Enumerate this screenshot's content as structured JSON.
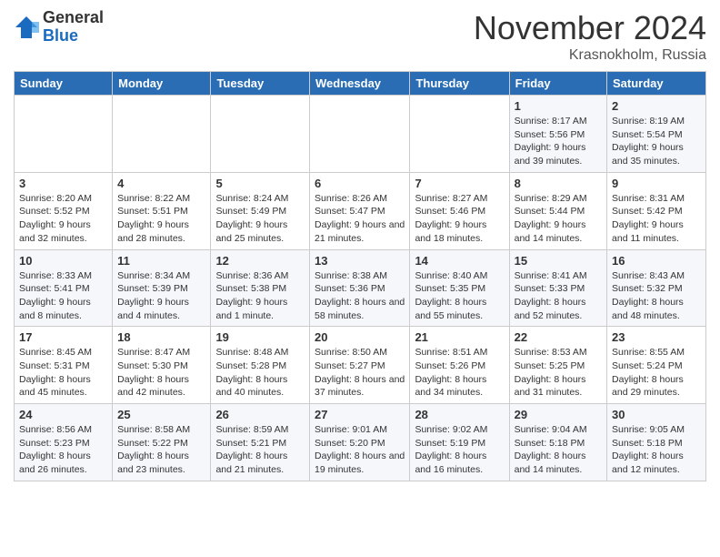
{
  "logo": {
    "general": "General",
    "blue": "Blue"
  },
  "header": {
    "month": "November 2024",
    "location": "Krasnokholm, Russia"
  },
  "weekdays": [
    "Sunday",
    "Monday",
    "Tuesday",
    "Wednesday",
    "Thursday",
    "Friday",
    "Saturday"
  ],
  "weeks": [
    [
      {
        "day": "",
        "info": ""
      },
      {
        "day": "",
        "info": ""
      },
      {
        "day": "",
        "info": ""
      },
      {
        "day": "",
        "info": ""
      },
      {
        "day": "",
        "info": ""
      },
      {
        "day": "1",
        "info": "Sunrise: 8:17 AM\nSunset: 5:56 PM\nDaylight: 9 hours and 39 minutes."
      },
      {
        "day": "2",
        "info": "Sunrise: 8:19 AM\nSunset: 5:54 PM\nDaylight: 9 hours and 35 minutes."
      }
    ],
    [
      {
        "day": "3",
        "info": "Sunrise: 8:20 AM\nSunset: 5:52 PM\nDaylight: 9 hours and 32 minutes."
      },
      {
        "day": "4",
        "info": "Sunrise: 8:22 AM\nSunset: 5:51 PM\nDaylight: 9 hours and 28 minutes."
      },
      {
        "day": "5",
        "info": "Sunrise: 8:24 AM\nSunset: 5:49 PM\nDaylight: 9 hours and 25 minutes."
      },
      {
        "day": "6",
        "info": "Sunrise: 8:26 AM\nSunset: 5:47 PM\nDaylight: 9 hours and 21 minutes."
      },
      {
        "day": "7",
        "info": "Sunrise: 8:27 AM\nSunset: 5:46 PM\nDaylight: 9 hours and 18 minutes."
      },
      {
        "day": "8",
        "info": "Sunrise: 8:29 AM\nSunset: 5:44 PM\nDaylight: 9 hours and 14 minutes."
      },
      {
        "day": "9",
        "info": "Sunrise: 8:31 AM\nSunset: 5:42 PM\nDaylight: 9 hours and 11 minutes."
      }
    ],
    [
      {
        "day": "10",
        "info": "Sunrise: 8:33 AM\nSunset: 5:41 PM\nDaylight: 9 hours and 8 minutes."
      },
      {
        "day": "11",
        "info": "Sunrise: 8:34 AM\nSunset: 5:39 PM\nDaylight: 9 hours and 4 minutes."
      },
      {
        "day": "12",
        "info": "Sunrise: 8:36 AM\nSunset: 5:38 PM\nDaylight: 9 hours and 1 minute."
      },
      {
        "day": "13",
        "info": "Sunrise: 8:38 AM\nSunset: 5:36 PM\nDaylight: 8 hours and 58 minutes."
      },
      {
        "day": "14",
        "info": "Sunrise: 8:40 AM\nSunset: 5:35 PM\nDaylight: 8 hours and 55 minutes."
      },
      {
        "day": "15",
        "info": "Sunrise: 8:41 AM\nSunset: 5:33 PM\nDaylight: 8 hours and 52 minutes."
      },
      {
        "day": "16",
        "info": "Sunrise: 8:43 AM\nSunset: 5:32 PM\nDaylight: 8 hours and 48 minutes."
      }
    ],
    [
      {
        "day": "17",
        "info": "Sunrise: 8:45 AM\nSunset: 5:31 PM\nDaylight: 8 hours and 45 minutes."
      },
      {
        "day": "18",
        "info": "Sunrise: 8:47 AM\nSunset: 5:30 PM\nDaylight: 8 hours and 42 minutes."
      },
      {
        "day": "19",
        "info": "Sunrise: 8:48 AM\nSunset: 5:28 PM\nDaylight: 8 hours and 40 minutes."
      },
      {
        "day": "20",
        "info": "Sunrise: 8:50 AM\nSunset: 5:27 PM\nDaylight: 8 hours and 37 minutes."
      },
      {
        "day": "21",
        "info": "Sunrise: 8:51 AM\nSunset: 5:26 PM\nDaylight: 8 hours and 34 minutes."
      },
      {
        "day": "22",
        "info": "Sunrise: 8:53 AM\nSunset: 5:25 PM\nDaylight: 8 hours and 31 minutes."
      },
      {
        "day": "23",
        "info": "Sunrise: 8:55 AM\nSunset: 5:24 PM\nDaylight: 8 hours and 29 minutes."
      }
    ],
    [
      {
        "day": "24",
        "info": "Sunrise: 8:56 AM\nSunset: 5:23 PM\nDaylight: 8 hours and 26 minutes."
      },
      {
        "day": "25",
        "info": "Sunrise: 8:58 AM\nSunset: 5:22 PM\nDaylight: 8 hours and 23 minutes."
      },
      {
        "day": "26",
        "info": "Sunrise: 8:59 AM\nSunset: 5:21 PM\nDaylight: 8 hours and 21 minutes."
      },
      {
        "day": "27",
        "info": "Sunrise: 9:01 AM\nSunset: 5:20 PM\nDaylight: 8 hours and 19 minutes."
      },
      {
        "day": "28",
        "info": "Sunrise: 9:02 AM\nSunset: 5:19 PM\nDaylight: 8 hours and 16 minutes."
      },
      {
        "day": "29",
        "info": "Sunrise: 9:04 AM\nSunset: 5:18 PM\nDaylight: 8 hours and 14 minutes."
      },
      {
        "day": "30",
        "info": "Sunrise: 9:05 AM\nSunset: 5:18 PM\nDaylight: 8 hours and 12 minutes."
      }
    ]
  ]
}
